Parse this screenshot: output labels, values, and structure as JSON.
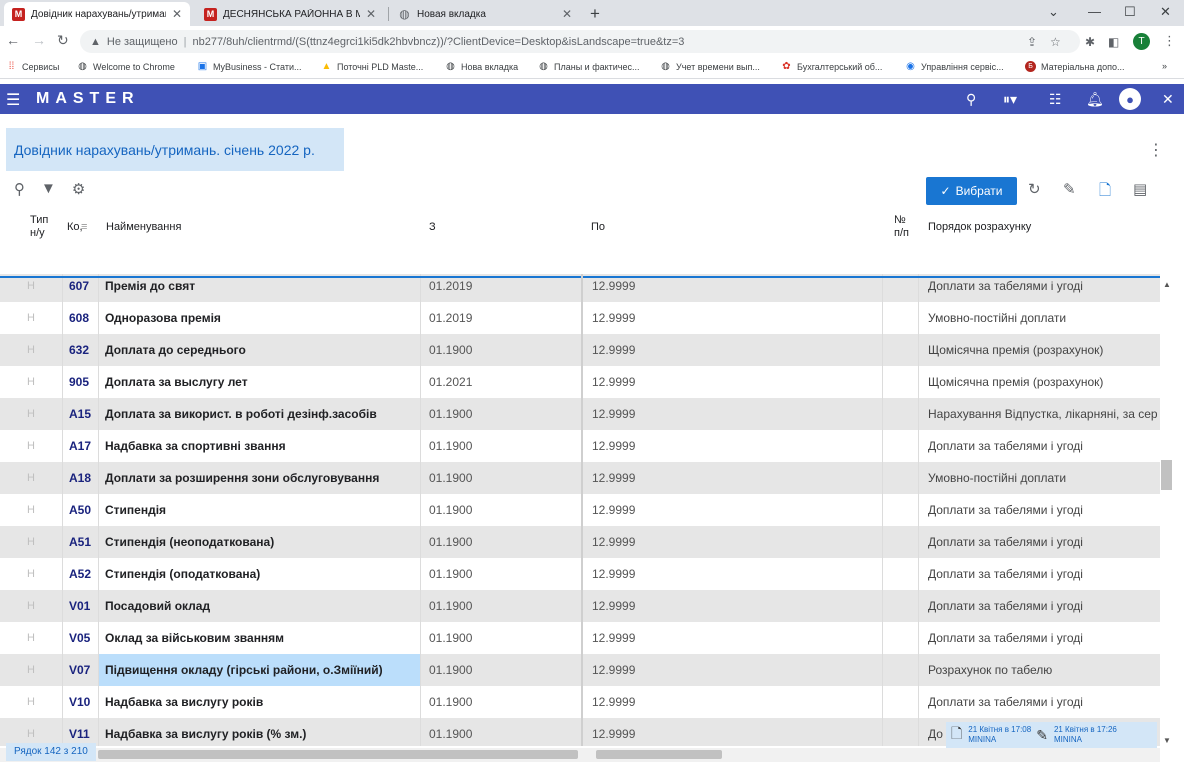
{
  "browser": {
    "tabs": [
      {
        "title": "Довідник нарахувань/утриман…",
        "icon": "app-m-icon",
        "active": true
      },
      {
        "title": "ДЕСНЯНСЬКА РАЙОННА В МІС…",
        "icon": "app-m-icon",
        "active": false
      },
      {
        "title": "Новая вкладка",
        "icon": "globe-icon",
        "active": false
      }
    ],
    "security_label": "Не защищено",
    "url": "nb277/8uh/clientrmd/(S(ttnz4egrci1ki5dk2hbvbncz))/?ClientDevice=Desktop&isLandscape=true&tz=3",
    "profile_letter": "T",
    "bookmarks": [
      {
        "label": "Сервисы",
        "icon": "apps-grid-icon"
      },
      {
        "label": "Welcome to Chrome",
        "icon": "globe-icon"
      },
      {
        "label": "MyBusiness - Стати...",
        "icon": "mybusiness-icon"
      },
      {
        "label": "Поточні PLD Maste...",
        "icon": "drive-icon"
      },
      {
        "label": "Нова вкладка",
        "icon": "globe-icon"
      },
      {
        "label": "Планы и фактичес...",
        "icon": "globe-icon"
      },
      {
        "label": "Учет времени вып...",
        "icon": "globe-icon"
      },
      {
        "label": "Бухгалтерський об...",
        "icon": "flower-icon"
      },
      {
        "label": "Управління сервіс...",
        "icon": "service-icon"
      },
      {
        "label": "Матеріальна допо...",
        "icon": "b-icon"
      }
    ]
  },
  "app": {
    "brand": "MASTER",
    "page_title": "Довідник нарахувань/утримань. січень 2022 р.",
    "select_button": "Вибрати",
    "columns": {
      "type": "Тип н/у",
      "code": "Ко,",
      "name": "Найменування",
      "from": "З",
      "to": "По",
      "num": "№ п/п",
      "order": "Порядок розрахунку"
    },
    "rows": [
      {
        "type": "Н",
        "code": "607",
        "name": "Премія до свят",
        "from": "01.2019",
        "to": "12.9999",
        "order": "Доплати за табелями і угоді"
      },
      {
        "type": "Н",
        "code": "608",
        "name": "Одноразова премія",
        "from": "01.2019",
        "to": "12.9999",
        "order": "Умовно-постійні доплати"
      },
      {
        "type": "Н",
        "code": "632",
        "name": "Доплата до середнього",
        "from": "01.1900",
        "to": "12.9999",
        "order": "Щомісячна премія (розрахунок)"
      },
      {
        "type": "Н",
        "code": "905",
        "name": "Доплата за выслугу лет",
        "from": "01.2021",
        "to": "12.9999",
        "order": "Щомісячна премія (розрахунок)"
      },
      {
        "type": "Н",
        "code": "A15",
        "name": "Доплата за використ. в роботі дезінф.засобів",
        "from": "01.1900",
        "to": "12.9999",
        "order": "Нарахування Відпустка, лікарняні, за сер"
      },
      {
        "type": "Н",
        "code": "A17",
        "name": "Надбавка за спортивні звання",
        "from": "01.1900",
        "to": "12.9999",
        "order": "Доплати за табелями і угоді"
      },
      {
        "type": "Н",
        "code": "A18",
        "name": "Доплати за розширення зони обслуговування",
        "from": "01.1900",
        "to": "12.9999",
        "order": "Умовно-постійні доплати"
      },
      {
        "type": "Н",
        "code": "A50",
        "name": "Стипендія",
        "from": "01.1900",
        "to": "12.9999",
        "order": "Доплати за табелями і угоді"
      },
      {
        "type": "Н",
        "code": "A51",
        "name": "Стипендія (неоподаткована)",
        "from": "01.1900",
        "to": "12.9999",
        "order": "Доплати за табелями і угоді"
      },
      {
        "type": "Н",
        "code": "A52",
        "name": "Стипендія (оподаткована)",
        "from": "01.1900",
        "to": "12.9999",
        "order": "Доплати за табелями і угоді"
      },
      {
        "type": "Н",
        "code": "V01",
        "name": "Посадовий оклад",
        "from": "01.1900",
        "to": "12.9999",
        "order": "Доплати за табелями і угоді"
      },
      {
        "type": "Н",
        "code": "V05",
        "name": "Оклад за військовим званням",
        "from": "01.1900",
        "to": "12.9999",
        "order": "Доплати за табелями і угоді"
      },
      {
        "type": "Н",
        "code": "V07",
        "name": "Підвищення окладу (гірські райони, о.Зміїний)",
        "from": "01.1900",
        "to": "12.9999",
        "order": "Розрахунок по табелю",
        "selected": true
      },
      {
        "type": "Н",
        "code": "V10",
        "name": "Надбавка за вислугу років",
        "from": "01.1900",
        "to": "12.9999",
        "order": "Доплати за табелями і угоді"
      },
      {
        "type": "Н",
        "code": "V11",
        "name": "Надбавка за вислугу років (% зм.)",
        "from": "01.1900",
        "to": "12.9999",
        "order": "До"
      }
    ],
    "row_count": "Рядок 142 з 210",
    "audit": {
      "created": "21 Квітня в 17:08",
      "created_by": "MININA",
      "edited": "21 Квітня в 17:26",
      "edited_by": "MININA"
    }
  }
}
